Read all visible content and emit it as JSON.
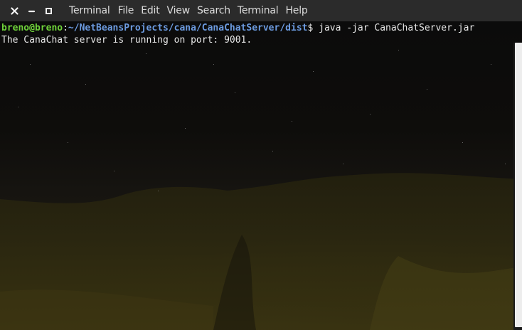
{
  "window": {
    "app_title": "Terminal",
    "controls": {
      "close": "close-icon",
      "minimize": "minimize-icon",
      "maximize": "maximize-icon"
    }
  },
  "menu": {
    "items": [
      {
        "label": "File"
      },
      {
        "label": "Edit"
      },
      {
        "label": "View"
      },
      {
        "label": "Search"
      },
      {
        "label": "Terminal"
      },
      {
        "label": "Help"
      }
    ]
  },
  "terminal": {
    "prompt": {
      "user_host": "breno@breno",
      "separator": ":",
      "path": "~/NetBeansProjects/cana/CanaChatServer/dist",
      "symbol": "$",
      "command": " java -jar CanaChatServer.jar"
    },
    "output": [
      "The CanaChat server is running on port: 9001."
    ]
  },
  "colors": {
    "titlebar_bg": "#2b2b2b",
    "prompt_user": "#6fd23a",
    "prompt_path": "#6c9be0",
    "text": "#e8e8e8",
    "scrollbar_thumb": "#ededed"
  }
}
